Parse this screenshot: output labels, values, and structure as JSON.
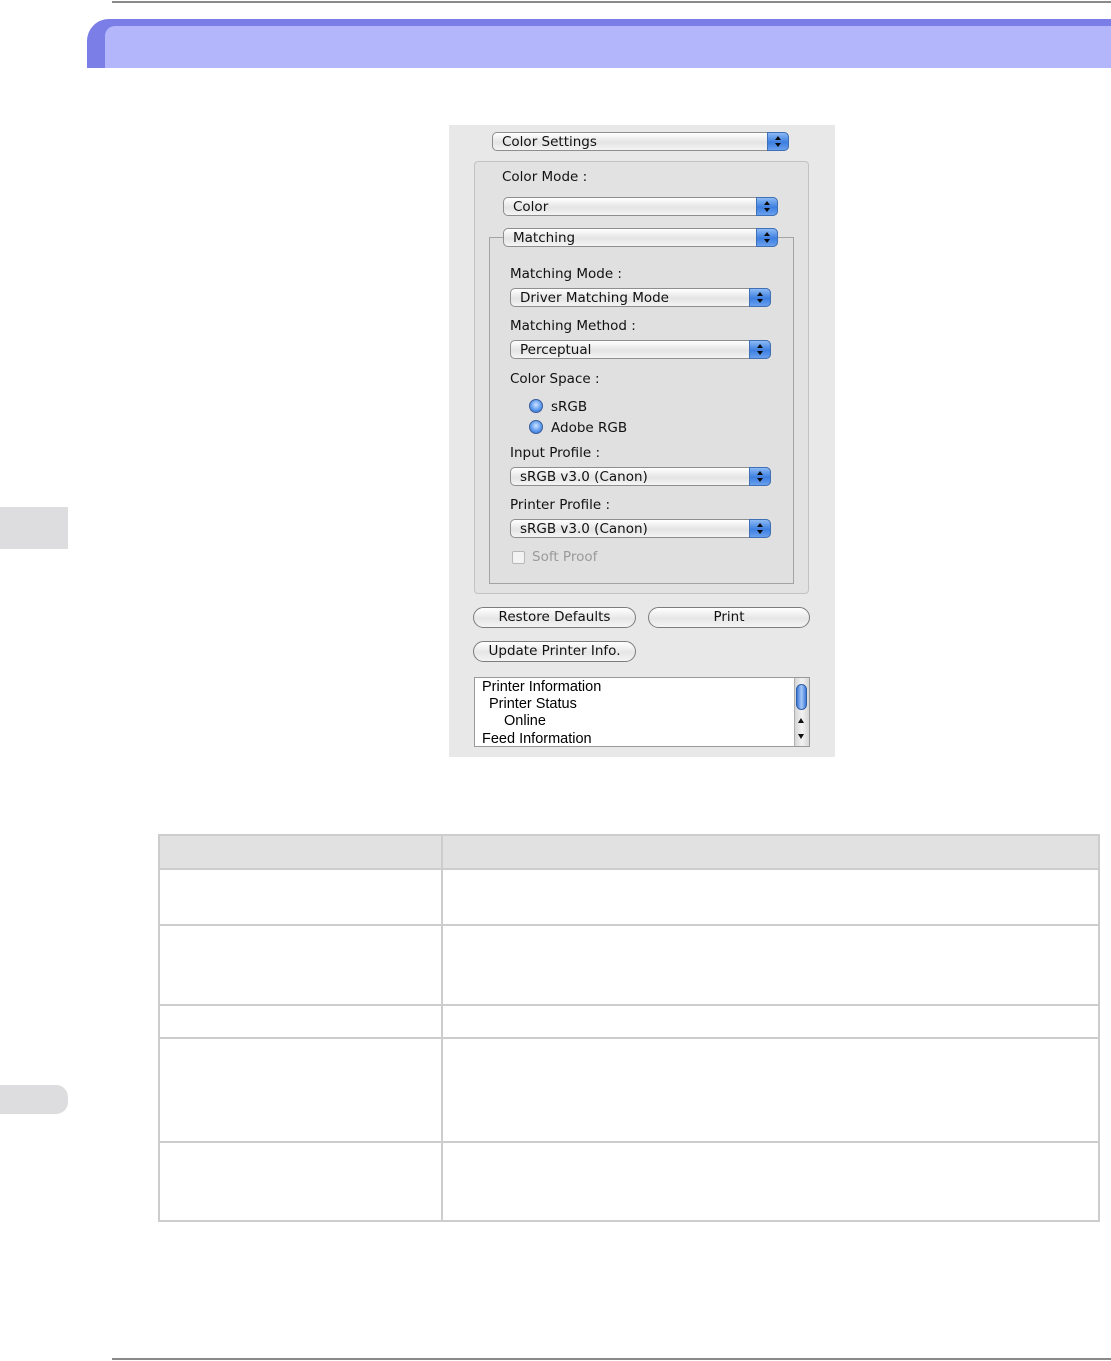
{
  "dialog": {
    "panel_selector": "Color Settings",
    "color_mode_label": "Color Mode :",
    "color_mode_value": "Color",
    "matching_group_selector": "Matching",
    "matching_mode_label": "Matching Mode :",
    "matching_mode_value": "Driver Matching Mode",
    "matching_method_label": "Matching Method :",
    "matching_method_value": "Perceptual",
    "color_space_label": "Color Space :",
    "color_space_options": [
      "sRGB",
      "Adobe RGB"
    ],
    "input_profile_label": "Input Profile :",
    "input_profile_value": "sRGB v3.0 (Canon)",
    "printer_profile_label": "Printer Profile :",
    "printer_profile_value": "sRGB v3.0 (Canon)",
    "soft_proof_label": "Soft Proof",
    "restore_defaults_label": "Restore Defaults",
    "print_label": "Print",
    "update_printer_info_label": "Update Printer Info.",
    "printer_info_items": [
      "Printer Information",
      "Printer Status",
      "Online",
      "Feed Information"
    ]
  },
  "colors": {
    "header_outer": "#7a7ee6",
    "header_inner": "#b4b6fb",
    "dialog_bg": "#e8e8e8",
    "accent_blue": "#3c7ee0"
  },
  "icons": [
    "popup-arrows-icon",
    "radio-button",
    "checkbox",
    "scroll-up-icon",
    "scroll-down-icon"
  ]
}
